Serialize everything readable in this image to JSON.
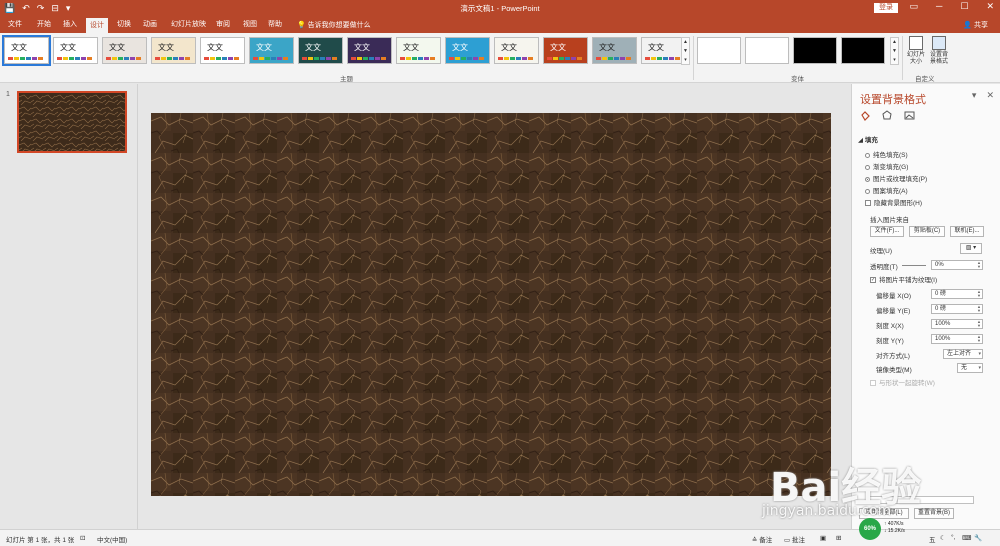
{
  "window": {
    "title": "演示文稿1  -  PowerPoint",
    "login": "登录",
    "controls": [
      "▭",
      "─",
      "☐",
      "✕"
    ]
  },
  "tabs": {
    "items": [
      "文件",
      "开始",
      "插入",
      "设计",
      "切换",
      "动画",
      "幻灯片放映",
      "审阅",
      "视图",
      "帮助"
    ],
    "active": "设计",
    "tell_me": "告诉我你想要做什么",
    "share": "共享"
  },
  "ribbon": {
    "themes": [
      {
        "label": "文文",
        "bg": "#ffffff"
      },
      {
        "label": "文文",
        "bg": "#ffffff"
      },
      {
        "label": "文文",
        "bg": "#e9e4df"
      },
      {
        "label": "文文",
        "bg": "#f3e6cc"
      },
      {
        "label": "文文",
        "bg": "#ffffff"
      },
      {
        "label": "文文",
        "bg": "#3ba5c7"
      },
      {
        "label": "文文",
        "bg": "#204b4a"
      },
      {
        "label": "文文",
        "bg": "#3a2b57"
      },
      {
        "label": "文文",
        "bg": "#f3f8ee"
      },
      {
        "label": "文文",
        "bg": "#2d9fd3"
      },
      {
        "label": "文文",
        "bg": "#f6f5ee"
      },
      {
        "label": "文文",
        "bg": "#b8401e"
      },
      {
        "label": "文文",
        "bg": "#9fb0b7"
      },
      {
        "label": "文文",
        "bg": "#f2f2f2"
      }
    ],
    "themes_group": "主题",
    "variants": [
      "#ffffff",
      "#ffffff",
      "#000000",
      "#000000"
    ],
    "variants_group": "变体",
    "slide_size_label": "幻灯片大小",
    "format_bg_label": "设置背景格式",
    "customize_group": "自定义"
  },
  "thumbs": {
    "number": "1"
  },
  "pane": {
    "title": "设置背景格式",
    "section": "填充",
    "fill_options": [
      {
        "label": "纯色填充(S)",
        "selected": false
      },
      {
        "label": "渐变填充(G)",
        "selected": false
      },
      {
        "label": "图片或纹理填充(P)",
        "selected": true
      },
      {
        "label": "图案填充(A)",
        "selected": false
      }
    ],
    "hide_bg": "隐藏背景图形(H)",
    "insert_from": "插入图片来自",
    "btn_file": "文件(F)...",
    "btn_clip": "剪贴板(C)",
    "btn_online": "联机(E)...",
    "texture_label": "纹理(U)",
    "transparency_label": "透明度(T)",
    "transparency_value": "0%",
    "tile_label": "将图片平铺为纹理(I)",
    "offset_x_label": "偏移量 X(O)",
    "offset_x": "0 磅",
    "offset_y_label": "偏移量 Y(E)",
    "offset_y": "0 磅",
    "scale_x_label": "刻度 X(X)",
    "scale_x": "100%",
    "scale_y_label": "刻度 Y(Y)",
    "scale_y": "100%",
    "align_label": "对齐方式(L)",
    "align_value": "左上对齐",
    "mirror_label": "镜像类型(M)",
    "mirror_value": "无",
    "rotate_label": "与形状一起旋转(W)",
    "apply_all": "应用到全部(L)",
    "reset": "重置背景(B)"
  },
  "status": {
    "slide_info": "幻灯片 第 1 张，共 1 张",
    "language": "中文(中国)",
    "notes": "备注",
    "comments": "批注",
    "net_percent": "60%",
    "upload": "↑ 407K/s",
    "download": "↓ 15.2K/s"
  },
  "watermark": {
    "brand": "Bai经验",
    "url": "jingyan.baidu.com"
  }
}
